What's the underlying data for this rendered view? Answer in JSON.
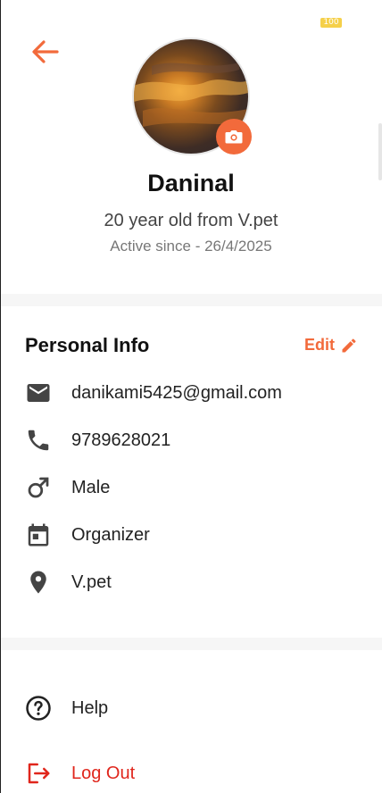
{
  "status_bar": {
    "battery": "100"
  },
  "profile": {
    "name": "Daninal",
    "subtitle": "20 year old from V.pet",
    "active_since": "Active since - 26/4/2025"
  },
  "personal_info": {
    "title": "Personal Info",
    "edit_label": "Edit",
    "email": "danikami5425@gmail.com",
    "phone": "9789628021",
    "gender": "Male",
    "role": "Organizer",
    "location": "V.pet"
  },
  "menu": {
    "help_label": "Help",
    "logout_label": "Log Out"
  },
  "colors": {
    "accent": "#f26a3b",
    "danger": "#e0261c",
    "icon": "#444444"
  }
}
